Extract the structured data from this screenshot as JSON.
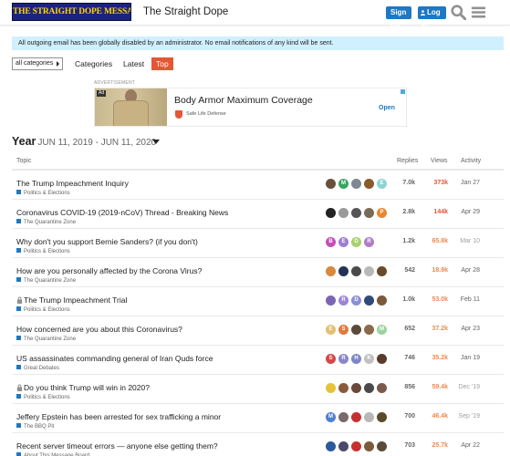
{
  "header": {
    "logo_text": "THE STRAIGHT DOPE MESSAGE BOARD",
    "site_title": "The Straight Dope",
    "signup_label": "Sign Up",
    "login_label": "Log In"
  },
  "banner": {
    "text": "All outgoing email has been globally disabled by an administrator. No email notifications of any kind will be sent."
  },
  "nav": {
    "category_select": "all categories",
    "categories_label": "Categories",
    "latest_label": "Latest",
    "top_label": "Top"
  },
  "ad": {
    "label": "ADVERTISEMENT",
    "badge": "Ad",
    "title": "Body Armor Maximum Coverage",
    "brand": "Safe Life Defense",
    "cta": "Open"
  },
  "period": {
    "label": "Year",
    "range": "JUN 11, 2019 - JUN 11, 2020"
  },
  "columns": {
    "topic": "Topic",
    "replies": "Replies",
    "views": "Views",
    "activity": "Activity"
  },
  "colors": {
    "views_hot": "#e45735",
    "views_warm": "#f0884f",
    "views_mild": "#f5a26f",
    "accent": "#1e78c2"
  },
  "topics": [
    {
      "title": "The Trump Impeachment Inquiry",
      "locked": false,
      "category": "Politics & Elections",
      "cat_color": "#1e78c2",
      "replies": "7.0k",
      "views": "373k",
      "views_level": "hot",
      "activity": "Jan 27",
      "stale": false,
      "posters": [
        {
          "letter": "",
          "color": "#6b4f3a"
        },
        {
          "letter": "M",
          "color": "#3aa35f"
        },
        {
          "letter": "",
          "color": "#7d8a92"
        },
        {
          "letter": "",
          "color": "#8a5a2b"
        },
        {
          "letter": "E",
          "color": "#8bd5d0"
        }
      ]
    },
    {
      "title": "Coronavirus COVID-19 (2019-nCoV) Thread - Breaking News",
      "locked": false,
      "category": "The Quarantine Zone",
      "cat_color": "#1e78c2",
      "replies": "2.8k",
      "views": "144k",
      "views_level": "hot",
      "activity": "Apr 29",
      "stale": false,
      "posters": [
        {
          "letter": "",
          "color": "#222222"
        },
        {
          "letter": "",
          "color": "#9a9a9a"
        },
        {
          "letter": "",
          "color": "#555555"
        },
        {
          "letter": "",
          "color": "#7a6a5a"
        },
        {
          "letter": "P",
          "color": "#e8872f"
        }
      ]
    },
    {
      "title": "Why don't you support Bernie Sanders? (if you don't)",
      "locked": false,
      "category": "Politics & Elections",
      "cat_color": "#1e78c2",
      "replies": "1.2k",
      "views": "65.8k",
      "views_level": "warm",
      "activity": "Mar 10",
      "stale": true,
      "posters": [
        {
          "letter": "B",
          "color": "#c44fb8"
        },
        {
          "letter": "E",
          "color": "#9c7fd1"
        },
        {
          "letter": "D",
          "color": "#a9d06a"
        },
        {
          "letter": "R",
          "color": "#b07cc8"
        }
      ]
    },
    {
      "title": "How are you personally affected by the Corona Virus?",
      "locked": false,
      "category": "The Quarantine Zone",
      "cat_color": "#1e78c2",
      "replies": "542",
      "views": "18.9k",
      "views_level": "warm",
      "activity": "Apr 28",
      "stale": false,
      "posters": [
        {
          "letter": "",
          "color": "#d8893a"
        },
        {
          "letter": "",
          "color": "#223355"
        },
        {
          "letter": "",
          "color": "#4a4a4a"
        },
        {
          "letter": "",
          "color": "#b8b8b8"
        },
        {
          "letter": "",
          "color": "#6a4a2a"
        }
      ]
    },
    {
      "title": "The Trump Impeachment Trial",
      "locked": true,
      "category": "Politics & Elections",
      "cat_color": "#1e78c2",
      "replies": "1.0k",
      "views": "53.0k",
      "views_level": "warm",
      "activity": "Feb 11",
      "stale": false,
      "posters": [
        {
          "letter": "",
          "color": "#7c66b3"
        },
        {
          "letter": "R",
          "color": "#9a86d6"
        },
        {
          "letter": "D",
          "color": "#8a8fd8"
        },
        {
          "letter": "",
          "color": "#2e4a7a"
        },
        {
          "letter": "",
          "color": "#7a5a3a"
        }
      ]
    },
    {
      "title": "How concerned are you about this Coronavirus?",
      "locked": false,
      "category": "The Quarantine Zone",
      "cat_color": "#1e78c2",
      "replies": "652",
      "views": "37.2k",
      "views_level": "warm",
      "activity": "Apr 23",
      "stale": false,
      "posters": [
        {
          "letter": "E",
          "color": "#e2c071"
        },
        {
          "letter": "S",
          "color": "#e07b3c"
        },
        {
          "letter": "",
          "color": "#5a4a3a"
        },
        {
          "letter": "",
          "color": "#8a6a4a"
        },
        {
          "letter": "M",
          "color": "#9cd39f"
        }
      ]
    },
    {
      "title": "US assassinates commanding general of Iran Quds force",
      "locked": false,
      "category": "Great Debates",
      "cat_color": "#1e78c2",
      "replies": "746",
      "views": "35.2k",
      "views_level": "warm",
      "activity": "Jan 19",
      "stale": false,
      "posters": [
        {
          "letter": "S",
          "color": "#d54747"
        },
        {
          "letter": "R",
          "color": "#8a86c8"
        },
        {
          "letter": "H",
          "color": "#7d86c6"
        },
        {
          "letter": "K",
          "color": "#c0c0c0"
        },
        {
          "letter": "",
          "color": "#5a3a2a"
        }
      ]
    },
    {
      "title": "Do you think Trump will win in 2020?",
      "locked": true,
      "category": "Politics & Elections",
      "cat_color": "#1e78c2",
      "replies": "856",
      "views": "59.4k",
      "views_level": "warm",
      "activity": "Dec '19",
      "stale": true,
      "posters": [
        {
          "letter": "",
          "color": "#e6c23a"
        },
        {
          "letter": "",
          "color": "#8a5a3a"
        },
        {
          "letter": "",
          "color": "#6a4a3a"
        },
        {
          "letter": "",
          "color": "#4a4a4a"
        },
        {
          "letter": "",
          "color": "#7a5a4a"
        }
      ]
    },
    {
      "title": "Jeffery Epstein has been arrested for sex trafficking a minor",
      "locked": false,
      "category": "The BBQ Pit",
      "cat_color": "#1e78c2",
      "replies": "700",
      "views": "46.4k",
      "views_level": "warm",
      "activity": "Sep '19",
      "stale": true,
      "posters": [
        {
          "letter": "M",
          "color": "#4f7fd0"
        },
        {
          "letter": "",
          "color": "#7a6a6a"
        },
        {
          "letter": "",
          "color": "#c63030"
        },
        {
          "letter": "",
          "color": "#b8b8b8"
        },
        {
          "letter": "",
          "color": "#5a4a2a"
        }
      ]
    },
    {
      "title": "Recent server timeout errors — anyone else getting them?",
      "locked": false,
      "category": "About This Message Board",
      "cat_color": "#1e78c2",
      "replies": "703",
      "views": "25.7k",
      "views_level": "warm",
      "activity": "Apr 22",
      "stale": false,
      "posters": [
        {
          "letter": "",
          "color": "#2a5a9a"
        },
        {
          "letter": "",
          "color": "#4a4a6a"
        },
        {
          "letter": "",
          "color": "#c83030"
        },
        {
          "letter": "",
          "color": "#7a5a3a"
        },
        {
          "letter": "",
          "color": "#5a4a3a"
        }
      ]
    }
  ]
}
